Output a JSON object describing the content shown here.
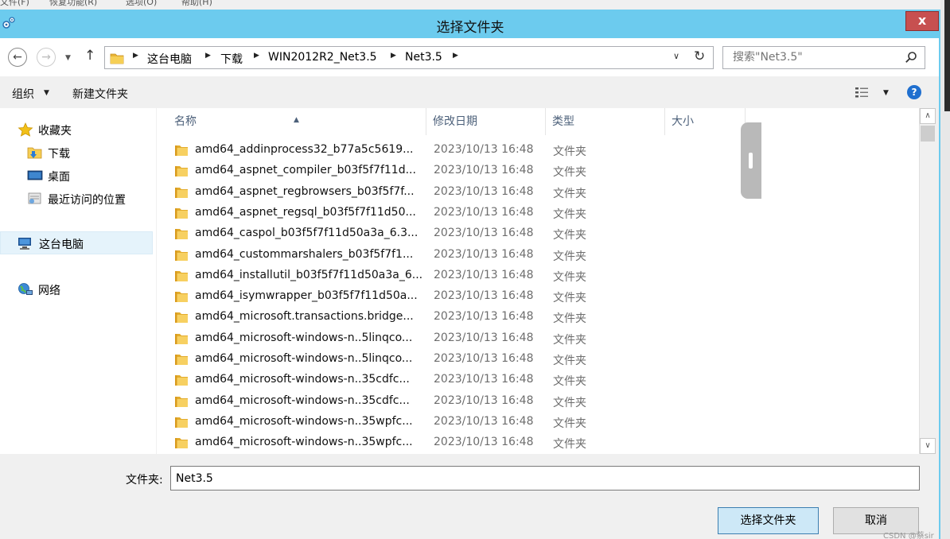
{
  "background_menu": [
    "文件(F)",
    "恢复功能(R)",
    "选项(O)",
    "帮助(H)"
  ],
  "window": {
    "title": "选择文件夹",
    "close_label": "x"
  },
  "nav": {
    "breadcrumbs": [
      "这台电脑",
      "下载",
      "WIN2012R2_Net3.5",
      "Net3.5"
    ],
    "search_placeholder": "搜索\"Net3.5\""
  },
  "toolbar": {
    "organize_label": "组织",
    "new_folder_label": "新建文件夹"
  },
  "sidebar": {
    "favorites_label": "收藏夹",
    "downloads_label": "下载",
    "desktop_label": "桌面",
    "recent_label": "最近访问的位置",
    "this_pc_label": "这台电脑",
    "network_label": "网络"
  },
  "columns": {
    "name": "名称",
    "modified": "修改日期",
    "type": "类型",
    "size": "大小"
  },
  "files": [
    {
      "name": "amd64_addinprocess32_b77a5c5619...",
      "date": "2023/10/13 16:48",
      "type": "文件夹"
    },
    {
      "name": "amd64_aspnet_compiler_b03f5f7f11d...",
      "date": "2023/10/13 16:48",
      "type": "文件夹"
    },
    {
      "name": "amd64_aspnet_regbrowsers_b03f5f7f...",
      "date": "2023/10/13 16:48",
      "type": "文件夹"
    },
    {
      "name": "amd64_aspnet_regsql_b03f5f7f11d50...",
      "date": "2023/10/13 16:48",
      "type": "文件夹"
    },
    {
      "name": "amd64_caspol_b03f5f7f11d50a3a_6.3...",
      "date": "2023/10/13 16:48",
      "type": "文件夹"
    },
    {
      "name": "amd64_custommarshalers_b03f5f7f1...",
      "date": "2023/10/13 16:48",
      "type": "文件夹"
    },
    {
      "name": "amd64_installutil_b03f5f7f11d50a3a_6...",
      "date": "2023/10/13 16:48",
      "type": "文件夹"
    },
    {
      "name": "amd64_isymwrapper_b03f5f7f11d50a...",
      "date": "2023/10/13 16:48",
      "type": "文件夹"
    },
    {
      "name": "amd64_microsoft.transactions.bridge...",
      "date": "2023/10/13 16:48",
      "type": "文件夹"
    },
    {
      "name": "amd64_microsoft-windows-n..5linqco...",
      "date": "2023/10/13 16:48",
      "type": "文件夹"
    },
    {
      "name": "amd64_microsoft-windows-n..5linqco...",
      "date": "2023/10/13 16:48",
      "type": "文件夹"
    },
    {
      "name": "amd64_microsoft-windows-n..35cdfc...",
      "date": "2023/10/13 16:48",
      "type": "文件夹"
    },
    {
      "name": "amd64_microsoft-windows-n..35cdfc...",
      "date": "2023/10/13 16:48",
      "type": "文件夹"
    },
    {
      "name": "amd64_microsoft-windows-n..35wpfc...",
      "date": "2023/10/13 16:48",
      "type": "文件夹"
    },
    {
      "name": "amd64_microsoft-windows-n..35wpfc...",
      "date": "2023/10/13 16:48",
      "type": "文件夹"
    }
  ],
  "bottom": {
    "folder_label": "文件夹:",
    "folder_value": "Net3.5",
    "select_button": "选择文件夹",
    "cancel_button": "取消"
  },
  "watermark": "CSDN @蔡sir"
}
